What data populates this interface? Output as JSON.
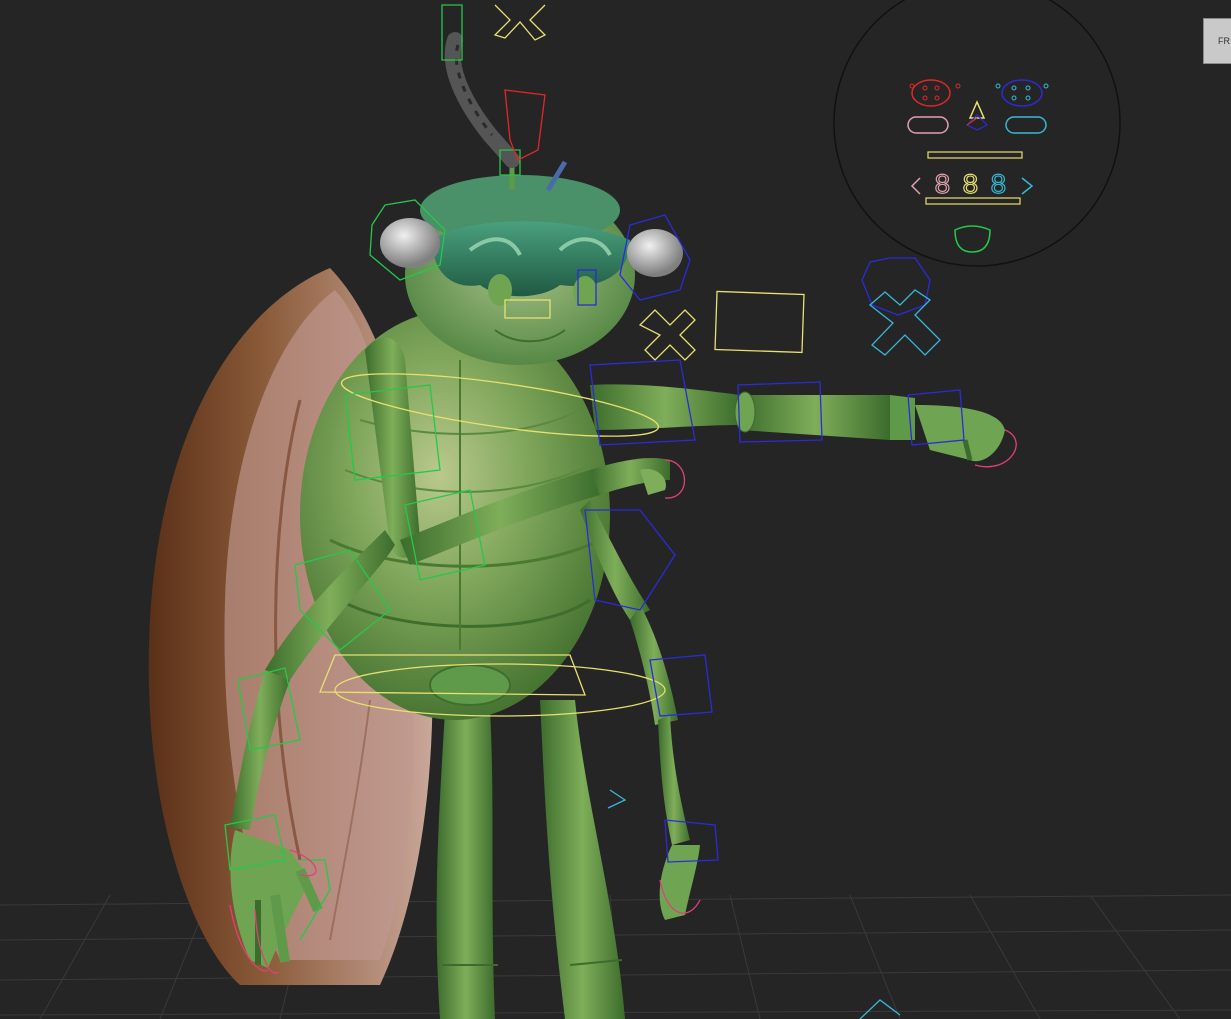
{
  "viewport": {
    "background": "#252525",
    "grid_color": "#3a3a3a",
    "model": "insect-character-rig"
  },
  "corner_tab": {
    "label": "FR"
  },
  "face_picker": {
    "readout": [
      "8",
      "8",
      "8"
    ]
  },
  "colors": {
    "control_green": "#25c84a",
    "control_blue": "#2b2bd8",
    "control_yellow": "#e8e070",
    "control_cyan": "#36b8d8",
    "control_pink": "#e0407a",
    "control_red": "#e02828",
    "skin": "#5f9a4a",
    "wing": "#7a4a2a"
  }
}
